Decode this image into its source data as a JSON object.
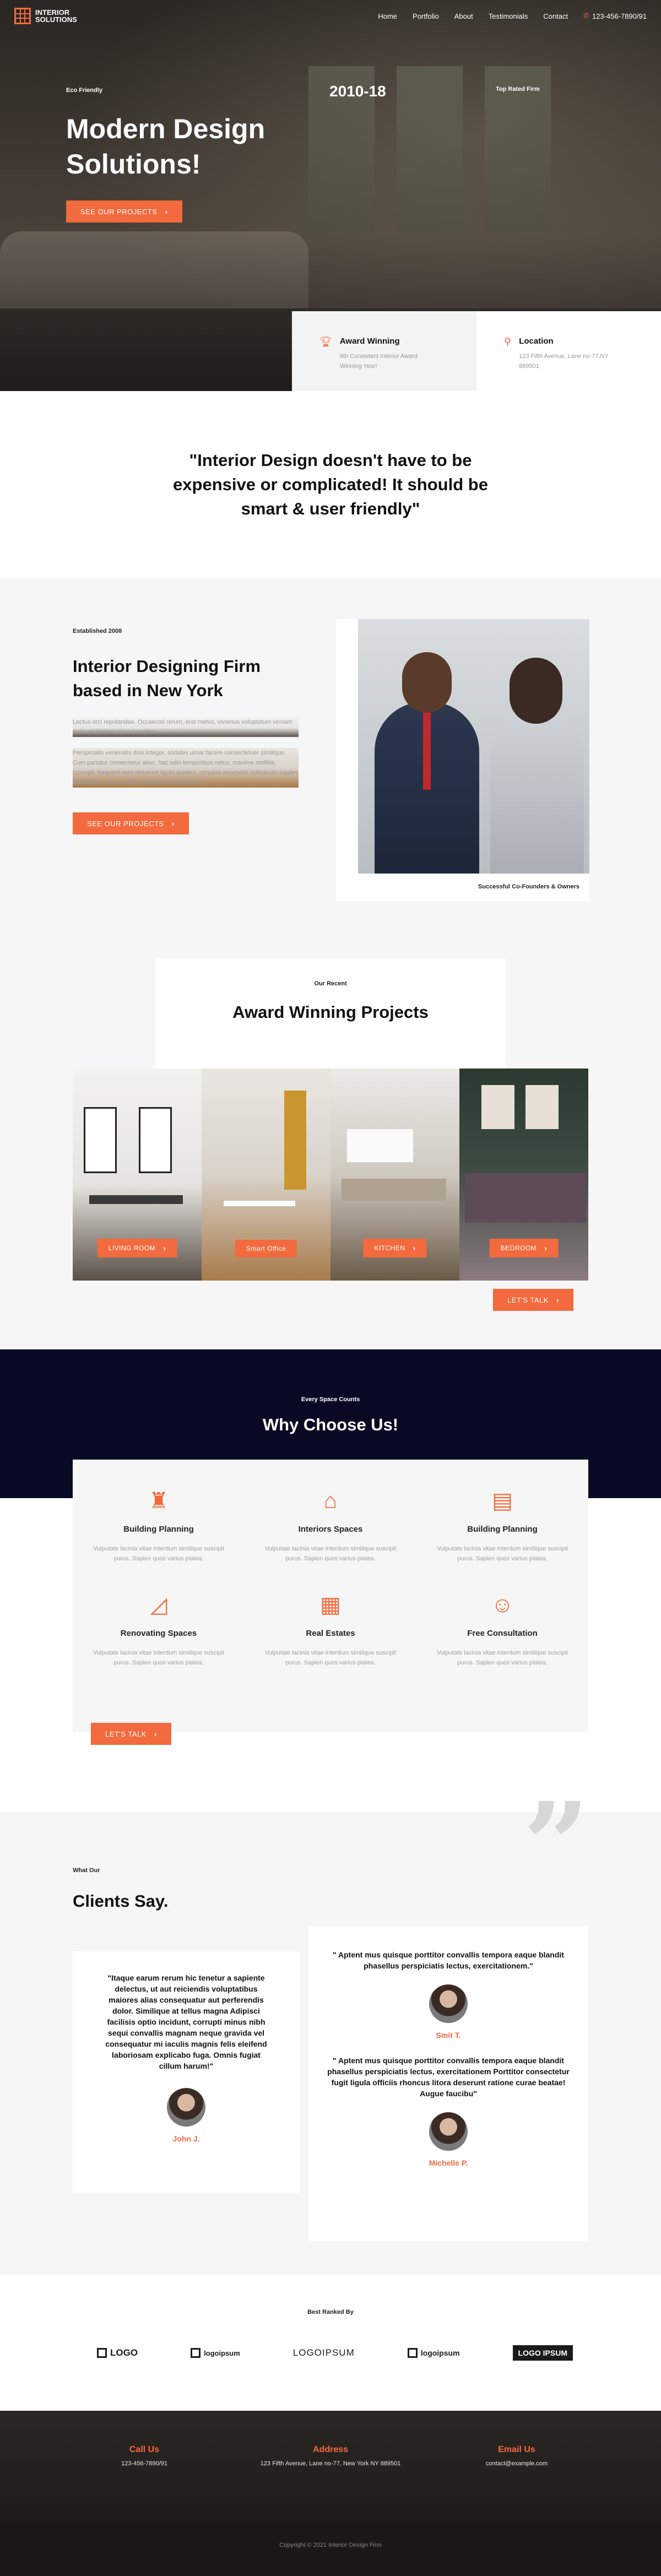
{
  "nav": {
    "logo_text_1": "INTERIOR",
    "logo_text_2": "SOLUTIONS",
    "items": [
      "Home",
      "Portfolio",
      "About",
      "Testimonials",
      "Contact"
    ],
    "phone": "123-456-7890/91"
  },
  "hero": {
    "small_left": "Eco Friendly",
    "years": "2010-18",
    "small_right": "Top Rated Firm",
    "title": "Modern Design Solutions!",
    "button": "SEE OUR PROJECTS",
    "cards": [
      {
        "title": "Award Winning",
        "text": "8th Consistent Interior Award Winning Year!"
      },
      {
        "title": "Location",
        "text": "123 Fifth Avenue, Lane no-77,NY 889501"
      }
    ]
  },
  "quote": {
    "text": "\"Interior Design doesn't have to be expensive or complicated! It should be smart & user friendly\""
  },
  "about": {
    "established": "Established 2008",
    "title": "Interior Designing Firm based in New York",
    "p1": "Lectus orci reputandae. Occaecati rerum, erat metus, vivamus voluptatum veniam sunt voluptatem alias excepturi.",
    "p2": "Perspiciatis venenatis duis integer, sodales urnar facere consectetuer similique. Cum pariatur consectetur alias, hac odio temporibus netus, maxime mollitia. Corrupti, torquent vero deserunt ligula quidem, conubia venenatis sollicitudin sapien laudantium neque! Officiis tempora praesentium.",
    "button": "SEE OUR PROJECTS",
    "caption": "Successful Co-Founders & Owners"
  },
  "projects": {
    "small": "Our Recent",
    "title": "Award Winning Projects",
    "items": [
      {
        "label": "LIVING ROOM"
      },
      {
        "label": "Smart Office"
      },
      {
        "label": "KITCHEN"
      },
      {
        "label": "BEDROOM"
      }
    ],
    "talk": "LET'S TALK"
  },
  "why": {
    "small": "Every Space Counts",
    "title": "Why Choose Us!",
    "items": [
      {
        "icon": "tower-crane-icon",
        "title": "Building Planning",
        "text": "Vulputate lacinia vitae interdum similique suscipit purus. Sapien quos varius platea."
      },
      {
        "icon": "rooms-icon",
        "title": "Interiors Spaces",
        "text": "Vulputate lacinia vitae interdum similique suscipit purus. Sapien quos varius platea."
      },
      {
        "icon": "blueprint-icon",
        "title": "Building Planning",
        "text": "Vulputate lacinia vitae interdum similique suscipit purus. Sapien quos varius platea."
      },
      {
        "icon": "set-square-icon",
        "title": "Renovating Spaces",
        "text": "Vulputate lacinia vitae interdum similique suscipit purus. Sapien quos varius platea."
      },
      {
        "icon": "building-icon",
        "title": "Real Estates",
        "text": "Vulputate lacinia vitae interdum similique suscipit purus. Sapien quos varius platea."
      },
      {
        "icon": "consultant-icon",
        "title": "Free Consultation",
        "text": "Vulputate lacinia vitae interdum similique suscipit purus. Sapien quos varius platea."
      }
    ],
    "button": "LET'S TALK"
  },
  "clients": {
    "small": "What Our",
    "title": "Clients Say.",
    "testimonials": [
      {
        "text": "\"Itaque earum rerum hic tenetur a sapiente delectus, ut aut reiciendis voluptatibus maiores alias consequatur aut perferendis dolor. Similique at tellus magna Adipisci facilisis optio incidunt, corrupti minus nibh sequi convallis magnam neque gravida vel consequatur mi iaculis magnis felis eleifend laboriosam explicabo fuga. Omnis fugiat cillum harum!\"",
        "name": "John J."
      },
      {
        "text": "\" Aptent mus quisque porttitor convallis tempora eaque blandit phasellus perspiciatis lectus, exercitationem.\"",
        "name": "Smit T."
      },
      {
        "text": "\" Aptent mus quisque porttitor convallis tempora eaque blandit phasellus perspiciatis lectus, exercitationem Porttitor consectetur fugit ligula officiis rhoncus litora deserunt ratione curae beatae! Augue faucibu\"",
        "name": "Michelle P."
      }
    ]
  },
  "logos": {
    "small": "Best Ranked By",
    "items": [
      "LOGO",
      "logoipsum",
      "LOGOIPSUM",
      "logoipsum",
      "LOGO IPSUM"
    ]
  },
  "footer": {
    "cols": [
      {
        "title": "Call Us",
        "text": "123-456-7890/91"
      },
      {
        "title": "Address",
        "text": "123 Fifth Avenue, Lane no-77, New York NY 889501"
      },
      {
        "title": "Email Us",
        "text": "contact@example.com"
      }
    ],
    "copyright": "Copyright © 2021 Interior Design Firm"
  },
  "colors": {
    "accent": "#f26a3d",
    "dark_navy": "#070a22",
    "light_gray": "#f6f6f6"
  }
}
